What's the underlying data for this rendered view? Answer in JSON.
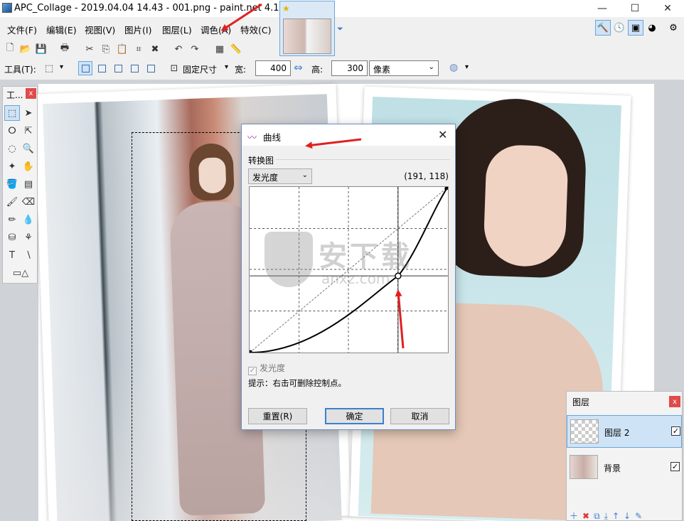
{
  "window": {
    "title": "APC_Collage - 2019.04.04 14.43 - 001.png - paint.net 4.1.4",
    "minimize": "—",
    "maximize": "☐",
    "close": "✕"
  },
  "menu": [
    "文件(F)",
    "编辑(E)",
    "视图(V)",
    "图片(I)",
    "图层(L)",
    "调色(A)",
    "特效(C)"
  ],
  "tool_options": {
    "tool_label": "工具(T):",
    "size_mode": "固定尺寸",
    "width_label": "宽:",
    "width_value": "400",
    "height_label": "高:",
    "height_value": "300",
    "unit": "像素"
  },
  "tools_panel": {
    "title": "工...",
    "close": "x"
  },
  "curves_dialog": {
    "title": "曲线",
    "section": "转换图",
    "mode": "发光度",
    "coordinates": "(191, 118)",
    "checkbox_label": "发光度",
    "hint": "提示：右击可删除控制点。",
    "reset_button": "重置(R)",
    "ok_button": "确定",
    "cancel_button": "取消",
    "control_point": {
      "input": 191,
      "output": 118
    }
  },
  "layers_panel": {
    "title": "图层",
    "close": "x",
    "layers": [
      {
        "name": "图层 2",
        "visible": true,
        "selected": true
      },
      {
        "name": "背景",
        "visible": true,
        "selected": false
      }
    ]
  },
  "watermark": {
    "text": "安下载",
    "sub": "anxz.com"
  },
  "colors": {
    "accent": "#cfe3f7",
    "accent_border": "#6aa5d8",
    "arrow": "#e02020",
    "close_red": "#e04a4a"
  }
}
